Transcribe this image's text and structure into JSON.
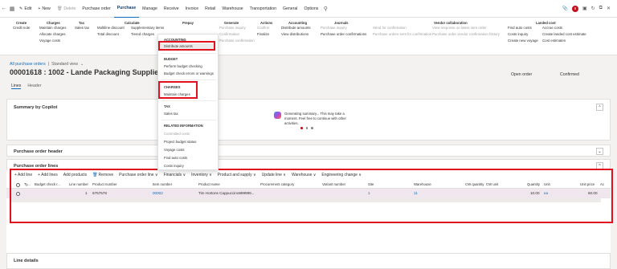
{
  "navbar": {
    "back_icon": "back-arrow-icon",
    "grid_icon": "grid-icon",
    "edit": "Edit",
    "new": "New",
    "delete": "Delete",
    "tabs": [
      "Purchase order",
      "Purchase",
      "Manage",
      "Receive",
      "Invoice",
      "Retail",
      "Warehouse",
      "Transportation",
      "General",
      "Options"
    ],
    "active_tab": "Purchase",
    "notification_count": "6"
  },
  "ribbon": {
    "create": {
      "title": "Create",
      "items": [
        "Credit note"
      ]
    },
    "charges": {
      "title": "Charges",
      "items": [
        "Maintain charges",
        "Allocate charges",
        "Voyage costs"
      ]
    },
    "tax": {
      "title": "Tax",
      "items": [
        "Sales tax"
      ]
    },
    "calculate": {
      "title": "Calculate",
      "items": [
        "Multiline discount",
        "Total discount",
        "Supplementary items",
        "Tiered charges"
      ]
    },
    "prepay": {
      "title": "Prepay"
    },
    "generate": {
      "title": "Generate",
      "items": [
        "Purchase inquiry",
        "Confirmation",
        "Purchase confirmation"
      ]
    },
    "actions": {
      "title": "Actions",
      "items": [
        "Confirm",
        "Finalize"
      ]
    },
    "accounting": {
      "title": "Accounting",
      "items": [
        "Distribute amounts",
        "View distributions"
      ]
    },
    "journals": {
      "title": "Journals",
      "items": [
        "Purchase inquiry",
        "Purchase order confirmations"
      ]
    },
    "vendor_collab_1": {
      "items": [
        "Send for confirmation",
        "Purchase orders sent for confirmation"
      ]
    },
    "vendor_collab": {
      "title": "Vendor collaboration",
      "items": [
        "View response on latest sent order",
        "Purchase order vendor confirmation history"
      ]
    },
    "landed_cost": {
      "title": "Landed cost",
      "items": [
        "Find auto costs",
        "Costs inquiry",
        "Create new voyage",
        "Accrue costs",
        "Create landed cost estimate",
        "Cost estimates"
      ]
    }
  },
  "menu": {
    "accounting_header": "ACCOUNTING",
    "distribute_amounts": "Distribute amounts",
    "budget_header": "BUDGET",
    "perform_budget_checking": "Perform budget checking",
    "budget_check_errors": "Budget check errors or warnings",
    "charges_header": "CHARGES",
    "maintain_charges": "Maintain charges",
    "tax_header": "TAX",
    "sales_tax": "Sales tax",
    "related_header": "RELATED INFORMATION",
    "committed_costs": "Committed costs",
    "project_budget_status": "Project budget status",
    "voyage_costs": "Voyage costs",
    "find_auto_costs": "Find auto costs",
    "costs_inquiry": "Costs inquiry"
  },
  "page": {
    "breadcrumb_link": "All purchase orders",
    "breadcrumb_sep": "|",
    "view": "Standard view",
    "title": "00001618 : 1002 - Lande Packaging Supplies",
    "status_order": "Open order",
    "status_approval": "Confirmed",
    "tabs": [
      "Lines",
      "Header"
    ]
  },
  "copilot": {
    "title": "Summary by Copilot",
    "message": "Generating summary... This may take a moment. Feel free to continue with other activities."
  },
  "sections": {
    "po_header": "Purchase order header",
    "po_lines": "Purchase order lines",
    "line_details": "Line details"
  },
  "lines_toolbar": [
    "+ Add line",
    "+ Add lines",
    "Add products",
    "Remove",
    "Purchase order line ∨",
    "Financials ∨",
    "Inventory ∨",
    "Product and supply ∨",
    "Update line ∨",
    "Warehouse ∨",
    "Engineering change ∨"
  ],
  "grid": {
    "columns": [
      "Ty...",
      "Budget check r...",
      "Line number",
      "Product number",
      "Item number",
      "Product name",
      "Procurement category",
      "Variant number",
      "Site",
      "Warehouse",
      "CW quantity",
      "CW unit",
      "Quantity",
      "Unit",
      "Unit price",
      "Ac"
    ],
    "row": {
      "line_number": "1",
      "product_number": "6757578",
      "item_number": "00002",
      "product_name": "Tim Hortons Cappuccino999999...",
      "site": "1",
      "warehouse": "11",
      "quantity": "10.00",
      "unit": "ea",
      "unit_price": "60.00"
    }
  },
  "colors": {
    "accent": "#0f6cbd",
    "highlight_box": "#e0101e",
    "selected_row": "#f0e6ed"
  }
}
